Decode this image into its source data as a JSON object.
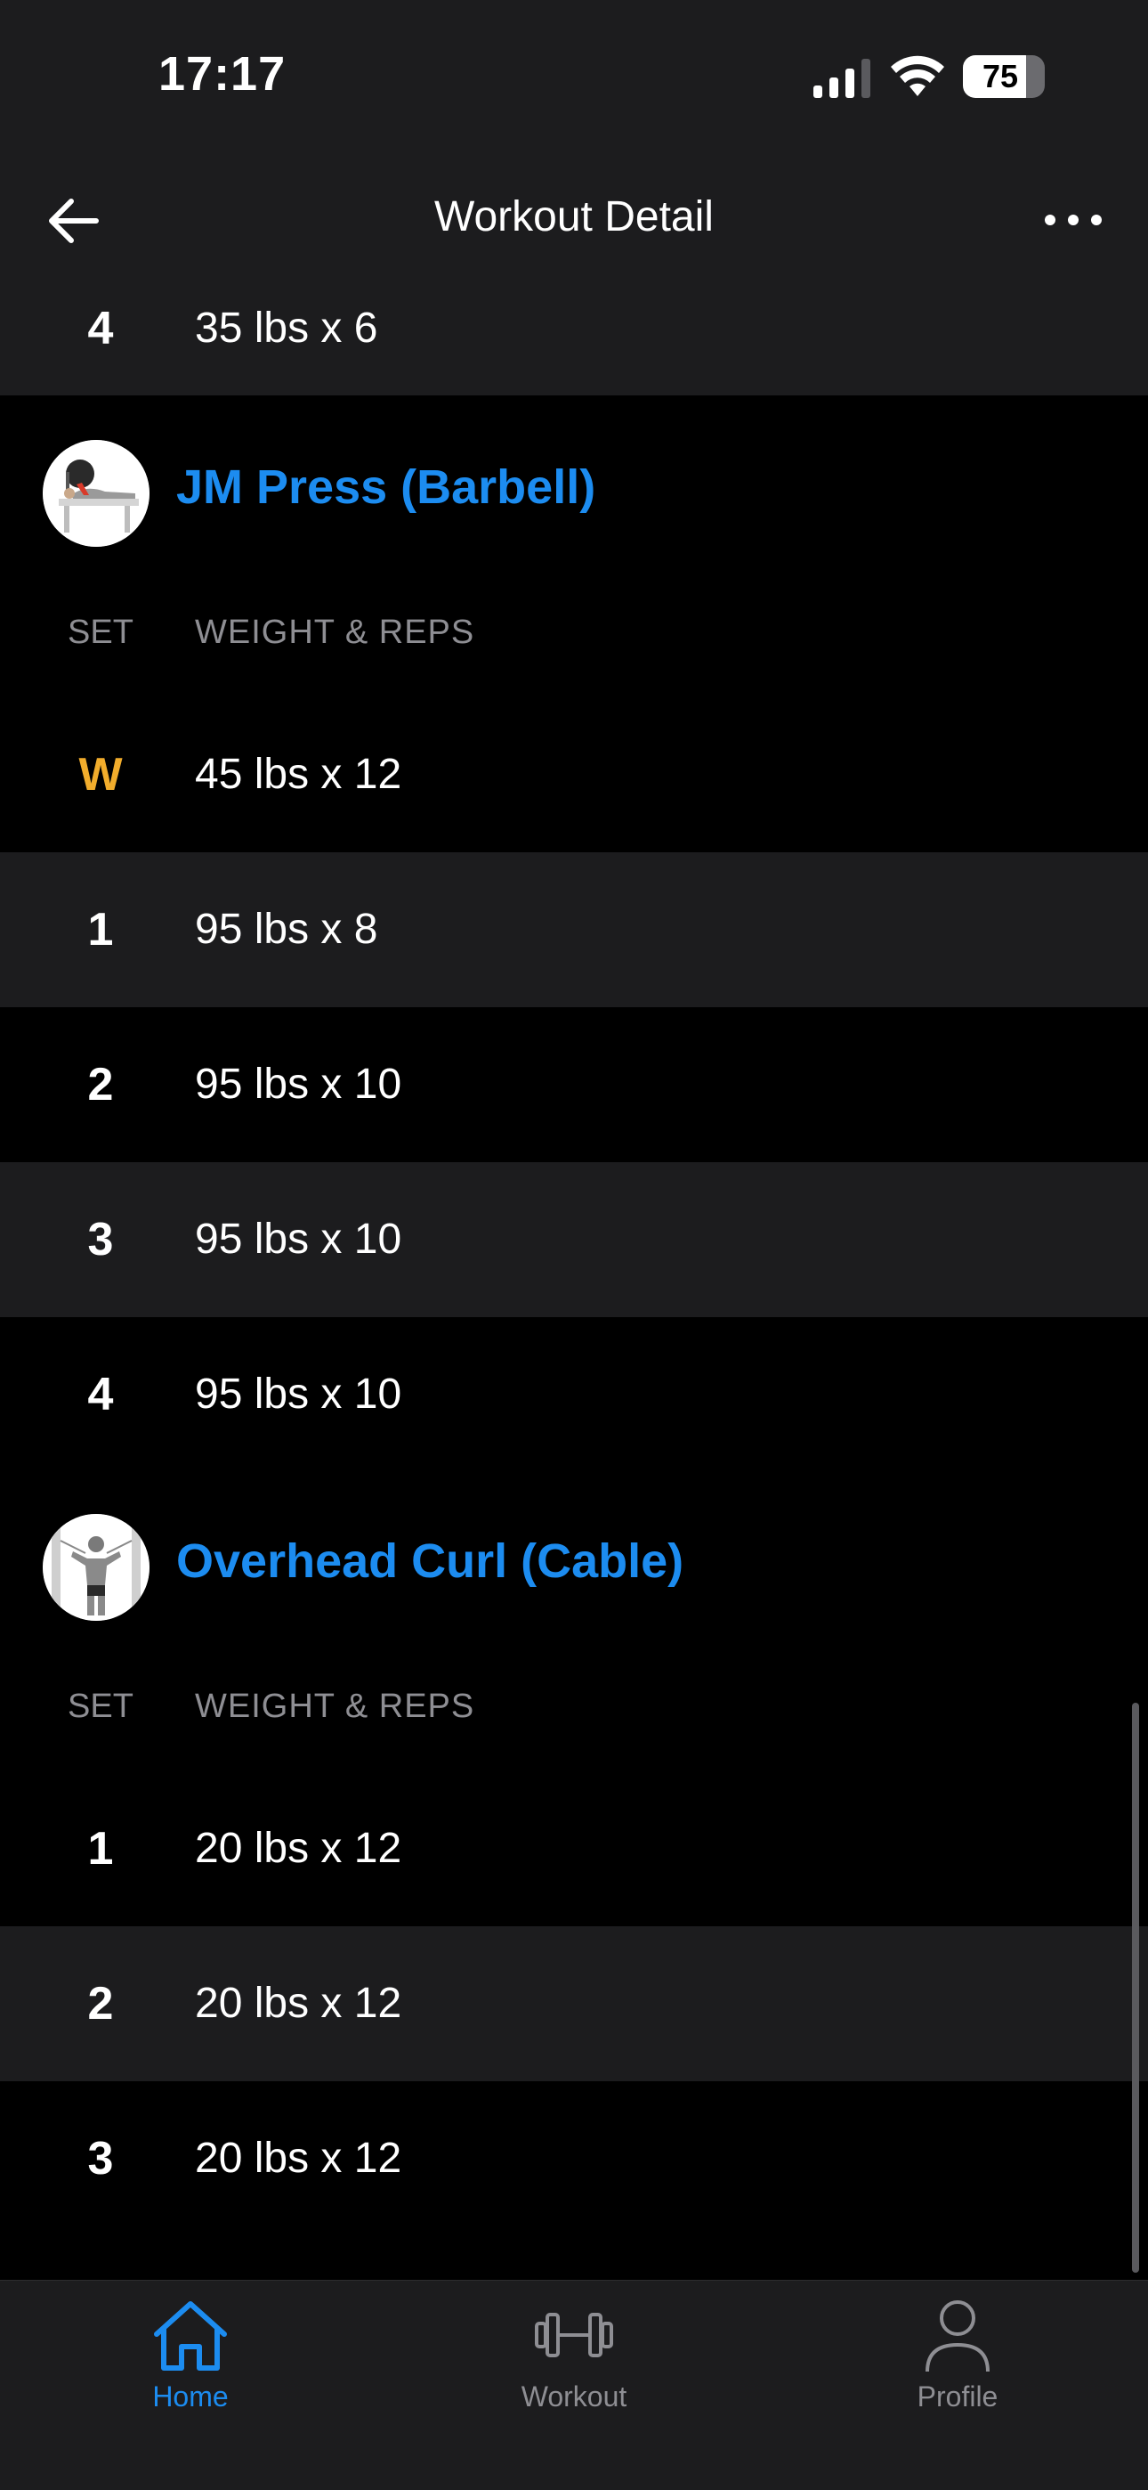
{
  "status_bar": {
    "time": "17:17",
    "battery": "75",
    "battery_level_percent": 75
  },
  "nav": {
    "title": "Workout Detail",
    "back_icon": "arrow-left-icon",
    "more_icon": "more-horizontal-icon"
  },
  "previous_exercise": {
    "rows": [
      {
        "set": "4",
        "value": "35 lbs x 6"
      }
    ]
  },
  "columns": {
    "set": "SET",
    "weight_reps": "WEIGHT & REPS"
  },
  "exercises": [
    {
      "name": "JM Press (Barbell)",
      "rows": [
        {
          "set": "W",
          "value": "45 lbs x 12"
        },
        {
          "set": "1",
          "value": "95 lbs x 8"
        },
        {
          "set": "2",
          "value": "95 lbs x 10"
        },
        {
          "set": "3",
          "value": "95 lbs x 10"
        },
        {
          "set": "4",
          "value": "95 lbs x 10"
        }
      ]
    },
    {
      "name": "Overhead Curl (Cable)",
      "rows": [
        {
          "set": "1",
          "value": "20 lbs x 12"
        },
        {
          "set": "2",
          "value": "20 lbs x 12"
        },
        {
          "set": "3",
          "value": "20 lbs x 12"
        }
      ]
    }
  ],
  "tabs": [
    {
      "label": "Home",
      "icon": "home-icon",
      "active": true
    },
    {
      "label": "Workout",
      "icon": "dumbbell-icon",
      "active": false
    },
    {
      "label": "Profile",
      "icon": "person-icon",
      "active": false
    }
  ],
  "colors": {
    "accent": "#1c8cf0",
    "warmup": "#f2ad2c",
    "row_alt": "#1c1c1e",
    "background": "#000000"
  }
}
